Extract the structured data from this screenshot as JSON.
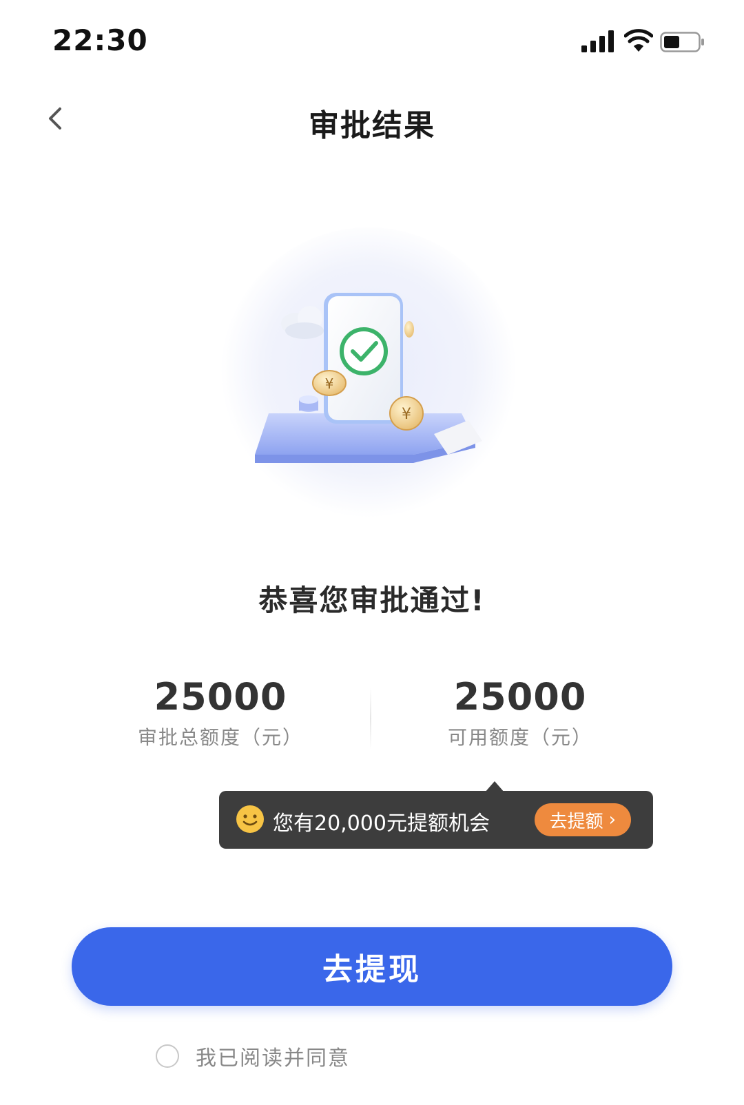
{
  "status_bar": {
    "time": "22:30",
    "icons": [
      "signal-icon",
      "wifi-icon",
      "battery-icon"
    ]
  },
  "nav": {
    "back_icon": "chevron-left-icon",
    "title": "审批结果"
  },
  "hero": {
    "icon": "approval-success-illustration"
  },
  "result": {
    "message": "恭喜您审批通过!"
  },
  "amounts": {
    "total": {
      "value": "25000",
      "label": "审批总额度（元）"
    },
    "available": {
      "value": "25000",
      "label": "可用额度（元）"
    }
  },
  "tooltip": {
    "icon": "smile-icon",
    "text": "您有20,000元提额机会",
    "button_label": "去提额",
    "button_chevron": "›"
  },
  "actions": {
    "withdraw_label": "去提现",
    "agree_text": "我已阅读并同意"
  },
  "colors": {
    "primary": "#3a67ea",
    "accent_orange": "#ee8a3e",
    "tooltip_bg": "#3d3d3d",
    "success_green": "#3cb36a"
  }
}
